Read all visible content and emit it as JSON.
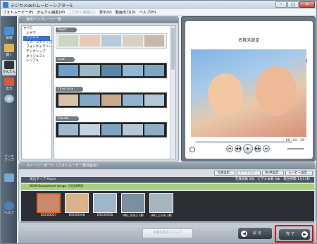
{
  "window": {
    "title": "デジカメde!!ムービーシアター5",
    "minimize_label": "─",
    "maximize_label": "□",
    "close_label": "✕"
  },
  "menu": [
    {
      "label": "フォトムービー(F)",
      "enabled": true
    },
    {
      "label": "かんたん編集(M)",
      "enabled": true
    },
    {
      "label": "こだわり編集(C)",
      "enabled": false
    },
    {
      "label": "表示(V)",
      "enabled": true
    },
    {
      "label": "動画出力(D)",
      "enabled": true
    },
    {
      "label": "ヘルプ(H)",
      "enabled": true
    }
  ],
  "leftnav": {
    "items": [
      {
        "label": "新規",
        "icon": "new-icon"
      },
      {
        "label": "開く",
        "icon": "open-icon"
      },
      {
        "label": "かんたん",
        "icon": "easy-edit-icon",
        "active": true
      },
      {
        "label": "出力",
        "icon": "output-icon"
      },
      {
        "label": "バック\nアップ",
        "icon": "backup-icon"
      },
      {
        "label": "ヘルプ",
        "icon": "help-icon"
      }
    ]
  },
  "template_panel": {
    "header": "演出テンプレート一覧",
    "categories": [
      {
        "label": "すべて",
        "level": 0,
        "selected": false
      },
      {
        "label": "シネマ",
        "level": 1,
        "selected": false
      },
      {
        "label": "デジタル",
        "level": 1,
        "selected": true
      },
      {
        "label": "イメージクリップ",
        "level": 1,
        "selected": false
      },
      {
        "label": "フォトギャラリー",
        "level": 1,
        "selected": false
      },
      {
        "label": "デジクリップ",
        "level": 1,
        "selected": false
      },
      {
        "label": "ダイジェスト",
        "level": 1,
        "selected": false
      },
      {
        "label": "シンプル",
        "level": 1,
        "selected": false
      }
    ],
    "templates": [
      {
        "name": "Paper",
        "style": "light"
      },
      {
        "name": "Leaf",
        "style": "dark"
      },
      {
        "name": "Time Line",
        "style": "dark"
      },
      {
        "name": "Clouds",
        "style": "dark"
      }
    ]
  },
  "preview": {
    "title": "名称未設定",
    "timecode": "00 . 02 . 29",
    "controls": [
      "⏮",
      "◀◀",
      "▶",
      "▶▶",
      "⏭"
    ]
  },
  "bottom_panel": {
    "header": "ストーリーボード（フォトムービー素材設定）",
    "buttons": [
      {
        "label": "写真設定...",
        "enabled": true
      },
      {
        "label": "ビデオ設定...",
        "enabled": false
      },
      {
        "label": "BGM設定...",
        "enabled": true
      },
      {
        "label": "ムービー設定...",
        "enabled": true
      }
    ],
    "effect_type": "演出タイプ Paper",
    "stats": "写真枚数 5枚　ビデオ本数 0本　再生時間 1分21秒",
    "bgm": "BGM:Saxophone tango（3分09秒）",
    "photos": [
      {
        "caption": "DSC00057",
        "color": "#c98a6a",
        "selected": true
      },
      {
        "caption": "DSC00048",
        "color": "#d9b38c",
        "selected": false
      },
      {
        "caption": "DSC00050",
        "color": "#9fb6c9",
        "selected": false
      },
      {
        "caption": "IMG_0043 3秒",
        "color": "#7c8f9e",
        "selected": false
      },
      {
        "caption": "IMG_1336 3秒",
        "color": "#a7b4bd",
        "selected": false
      }
    ]
  },
  "footer": {
    "drop_label": "不要写真をドロップ",
    "back_label": "戻 る",
    "finish_label": "完 了"
  }
}
